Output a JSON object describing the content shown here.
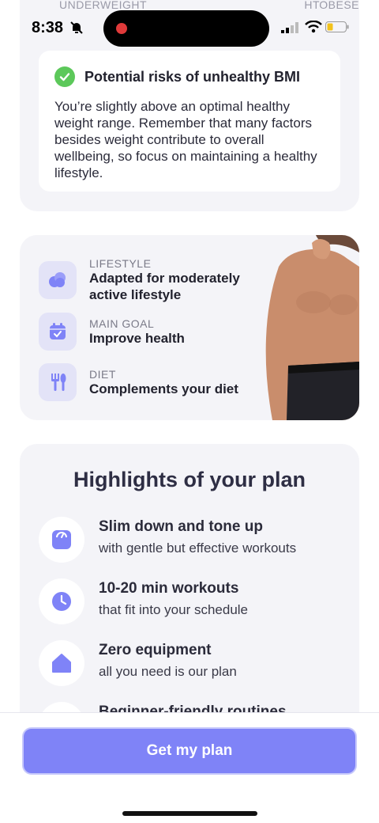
{
  "bmi": {
    "scale_labels": {
      "under": "UNDERWEIGHT",
      "over": "HT",
      "obese": "OBESE"
    },
    "risk_title": "Potential risks of unhealthy BMI",
    "risk_text": "You’re slightly above an optimal healthy weight range. Remember that many factors besides weight contribute to overall wellbeing, so focus on maintaining a healthy lifestyle."
  },
  "status_bar": {
    "time": "8:38"
  },
  "profile": {
    "items": [
      {
        "label": "LIFESTYLE",
        "value": "Adapted for moderately active lifestyle",
        "icon": "lifestyle-icon"
      },
      {
        "label": "MAIN GOAL",
        "value": "Improve health",
        "icon": "calendar-check-icon"
      },
      {
        "label": "DIET",
        "value": "Complements your diet",
        "icon": "fork-spoon-icon"
      }
    ]
  },
  "highlights": {
    "title": "Highlights of your plan",
    "items": [
      {
        "title": "Slim down and tone up",
        "subtitle": "with gentle but effective workouts",
        "icon": "scale-icon"
      },
      {
        "title": "10-20 min workouts",
        "subtitle": "that fit into your schedule",
        "icon": "clock-icon"
      },
      {
        "title": "Zero equipment",
        "subtitle": "all you need is our plan",
        "icon": "home-icon"
      },
      {
        "title": "Beginner-friendly routines",
        "subtitle": "",
        "icon": "star-icon"
      }
    ]
  },
  "cta": {
    "label": "Get my plan"
  },
  "colors": {
    "accent": "#7f83f7",
    "icon_bg": "#e3e3f7",
    "check": "#5cc85a"
  }
}
